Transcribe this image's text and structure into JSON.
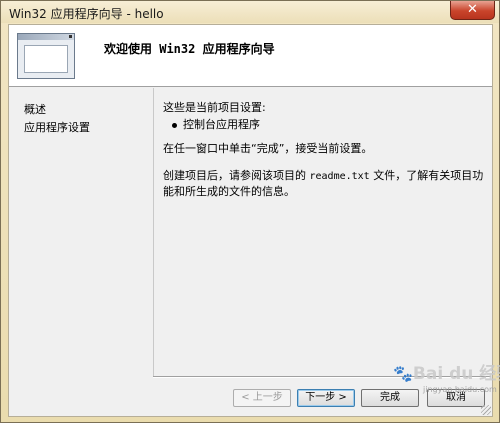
{
  "window": {
    "title": "Win32 应用程序向导 - hello",
    "close_icon": "x-icon"
  },
  "header": {
    "title": "欢迎使用 Win32 应用程序向导"
  },
  "nav": {
    "items": [
      {
        "label": "概述"
      },
      {
        "label": "应用程序设置"
      }
    ]
  },
  "content": {
    "line1": "这些是当前项目设置:",
    "bullet": "控制台应用程序",
    "line3": "在任一窗口中单击“完成”，接受当前设置。",
    "line4_a": "创建项目后，请参阅该项目的 ",
    "line4_file": "readme.txt",
    "line4_b": " 文件，了解有关项目功能和所生成的文件的信息。"
  },
  "buttons": {
    "prev": "< 上一步",
    "next": "下一步 >",
    "finish": "完成",
    "cancel": "取消"
  },
  "watermark": {
    "logo": "Bai du 经验",
    "sub": "jingyan.baidu.com"
  }
}
